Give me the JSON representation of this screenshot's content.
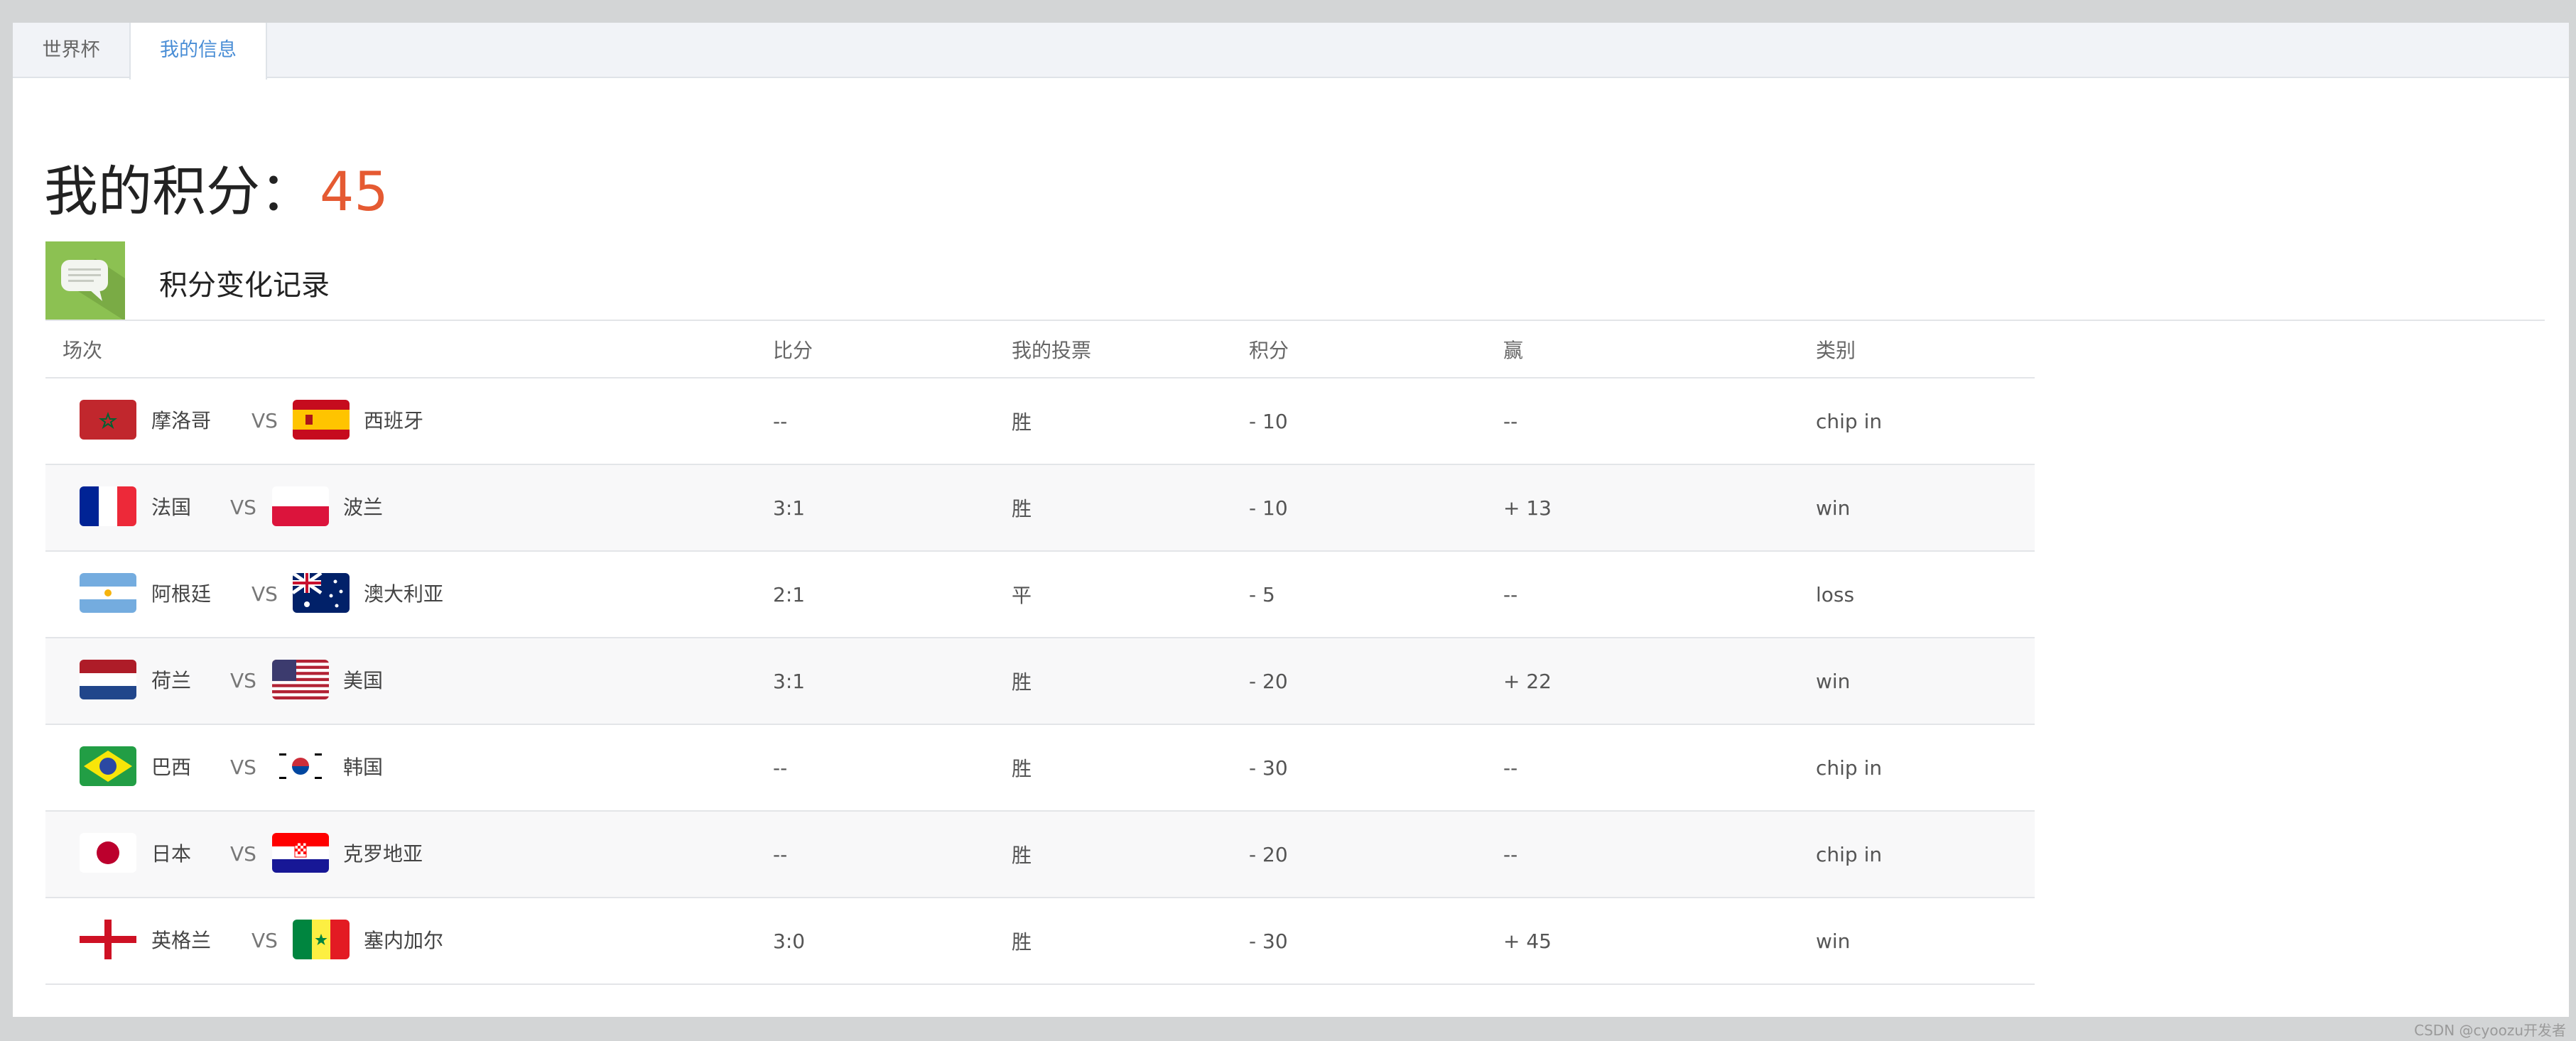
{
  "tabs": [
    {
      "label": "世界杯",
      "active": false
    },
    {
      "label": "我的信息",
      "active": true
    }
  ],
  "score": {
    "label": "我的积分：",
    "value": "45"
  },
  "section": {
    "title": "积分变化记录",
    "icon": "chat-bubble-icon"
  },
  "table": {
    "headers": [
      "场次",
      "比分",
      "我的投票",
      "积分",
      "赢",
      "类别"
    ],
    "rows": [
      {
        "home": "摩洛哥",
        "vs": "VS",
        "away": "西班牙",
        "ratio": "--",
        "vote": "胜",
        "points": "- 10",
        "win": "--",
        "category": "chip in",
        "type": "chip"
      },
      {
        "home": "法国",
        "vs": "VS",
        "away": "波兰",
        "ratio": "3:1",
        "vote": "胜",
        "points": "- 10",
        "win": "+ 13",
        "category": "win",
        "type": "win"
      },
      {
        "home": "阿根廷",
        "vs": "VS",
        "away": "澳大利亚",
        "ratio": "2:1",
        "vote": "平",
        "points": "- 5",
        "win": "--",
        "category": "loss",
        "type": "loss"
      },
      {
        "home": "荷兰",
        "vs": "VS",
        "away": "美国",
        "ratio": "3:1",
        "vote": "胜",
        "points": "- 20",
        "win": "+ 22",
        "category": "win",
        "type": "win"
      },
      {
        "home": "巴西",
        "vs": "VS",
        "away": "韩国",
        "ratio": "--",
        "vote": "胜",
        "points": "- 30",
        "win": "--",
        "category": "chip in",
        "type": "chip"
      },
      {
        "home": "日本",
        "vs": "VS",
        "away": "克罗地亚",
        "ratio": "--",
        "vote": "胜",
        "points": "- 20",
        "win": "--",
        "category": "chip in",
        "type": "chip"
      },
      {
        "home": "英格兰",
        "vs": "VS",
        "away": "塞内加尔",
        "ratio": "3:0",
        "vote": "胜",
        "points": "- 30",
        "win": "+ 45",
        "category": "win",
        "type": "win"
      }
    ]
  },
  "colors": {
    "accent": "#4a8ed6",
    "score": "#e55a32",
    "win": "#e0352b",
    "loss": "#2c8a2c",
    "icon_bg": "#8cc152"
  },
  "watermark": "CSDN @cyoozu开发者"
}
